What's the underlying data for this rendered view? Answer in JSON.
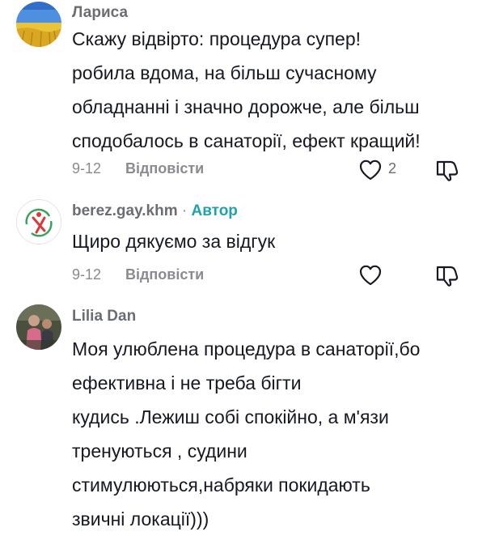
{
  "comments": [
    {
      "username": "Лариса",
      "is_author": false,
      "text_lines": [
        "Скажу відвірто: процедура супер!",
        "робила вдома, на більш сучасному",
        "обладнанні і значно дорожче, але більш",
        "сподобалось в санаторії, ефект кращий!"
      ],
      "date": "9-12",
      "reply_label": "Відповісти",
      "like_count": "2",
      "avatar_icon": "ukraine-flag-wheat-field-avatar"
    },
    {
      "username": "berez.gay.khm",
      "author_separator": "·",
      "author_badge": "Автор",
      "is_author": true,
      "text_lines": [
        "Щиро дякуємо за відгук"
      ],
      "date": "9-12",
      "reply_label": "Відповісти",
      "like_count": "",
      "avatar_icon": "logo-avatar"
    },
    {
      "username": "Lilia Dan",
      "is_author": false,
      "text_lines": [
        "Моя улюблена процедура в санаторії,бо",
        "ефективна і не треба бігти",
        "кудись .Лежиш собі спокійно, а м'язи",
        "тренуються , судини",
        "стимулюються,набряки покидають",
        "звичні локації)))"
      ],
      "avatar_icon": "photo-avatar"
    }
  ],
  "colors": {
    "username": "#6b6d74",
    "text": "#161823",
    "meta": "#8a8b91",
    "author_badge": "#20a3a8"
  }
}
